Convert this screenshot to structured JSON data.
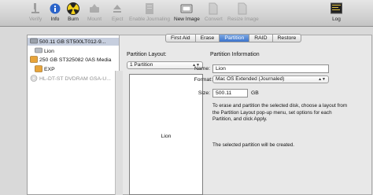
{
  "toolbar": {
    "buttons": [
      {
        "label": "Verify",
        "icon": "microscope-icon",
        "enabled": false
      },
      {
        "label": "Info",
        "icon": "info-icon",
        "enabled": true
      },
      {
        "label": "Burn",
        "icon": "burn-icon",
        "enabled": true
      },
      {
        "label": "Mount",
        "icon": "mount-icon",
        "enabled": false
      },
      {
        "label": "Eject",
        "icon": "eject-icon",
        "enabled": false
      },
      {
        "label": "Enable Journaling",
        "icon": "journal-icon",
        "enabled": false
      },
      {
        "label": "New Image",
        "icon": "new-image-icon",
        "enabled": true
      },
      {
        "label": "Convert",
        "icon": "convert-icon",
        "enabled": false
      },
      {
        "label": "Resize Image",
        "icon": "resize-image-icon",
        "enabled": false
      }
    ],
    "log_label": "Log"
  },
  "sidebar": {
    "items": [
      {
        "label": "500.11 GB ST500LT012-9...",
        "type": "disk",
        "selected": true
      },
      {
        "label": "Lion",
        "type": "volume"
      },
      {
        "label": "250 GB ST325082 0AS Media",
        "type": "disk"
      },
      {
        "label": "EXP",
        "type": "volume"
      },
      {
        "label": "HL-DT-ST DVDRAM GSA-U...",
        "type": "optical"
      }
    ]
  },
  "tabs": [
    "First Aid",
    "Erase",
    "Partition",
    "RAID",
    "Restore"
  ],
  "active_tab": "Partition",
  "partition": {
    "layout_label": "Partition Layout:",
    "layout_value": "1 Partition",
    "partition_name": "Lion",
    "info_title": "Partition Information",
    "name_label": "Name:",
    "name_value": "Lion",
    "format_label": "Format:",
    "format_value": "Mac OS Extended (Journaled)",
    "size_label": "Size:",
    "size_value": "500.11",
    "size_unit": "GB",
    "description": "To erase and partition the selected disk, choose a layout from the Partition Layout pop-up menu, set options for each Partition, and click Apply.",
    "status": "The selected partition will be created."
  },
  "colors": {
    "accent": "#3b73cc",
    "selection": "#c6cede"
  }
}
